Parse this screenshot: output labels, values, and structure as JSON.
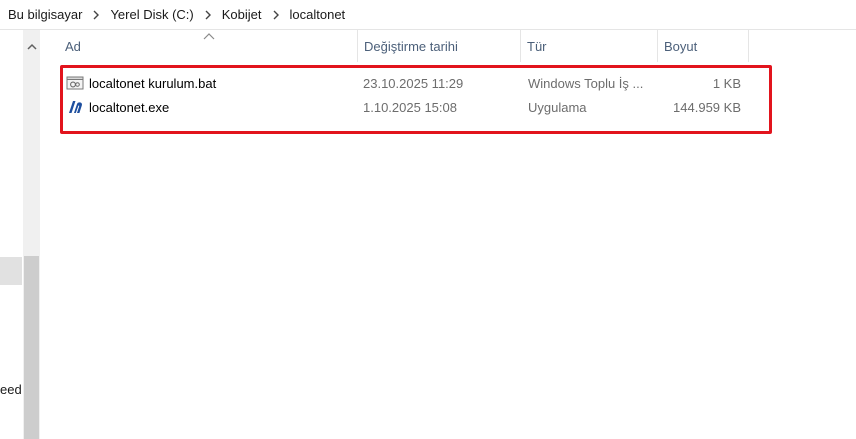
{
  "breadcrumb": {
    "items": [
      "Bu bilgisayar",
      "Yerel Disk (C:)",
      "Kobijet",
      "localtonet"
    ]
  },
  "nav": {
    "partial_label": "eed"
  },
  "columns": {
    "name": "Ad",
    "date": "Değiştirme tarihi",
    "type": "Tür",
    "size": "Boyut"
  },
  "files": [
    {
      "name": "localtonet kurulum.bat",
      "date": "23.10.2025 11:29",
      "type": "Windows Toplu İş ...",
      "size": "1 KB",
      "icon": "batch-file-icon"
    },
    {
      "name": "localtonet.exe",
      "date": "1.10.2025 15:08",
      "type": "Uygulama",
      "size": "144.959 KB",
      "icon": "localtonet-app-icon"
    }
  ],
  "colors": {
    "highlight": "#e2141d",
    "header_text": "#4c607a",
    "muted_text": "#6d6d6d"
  }
}
